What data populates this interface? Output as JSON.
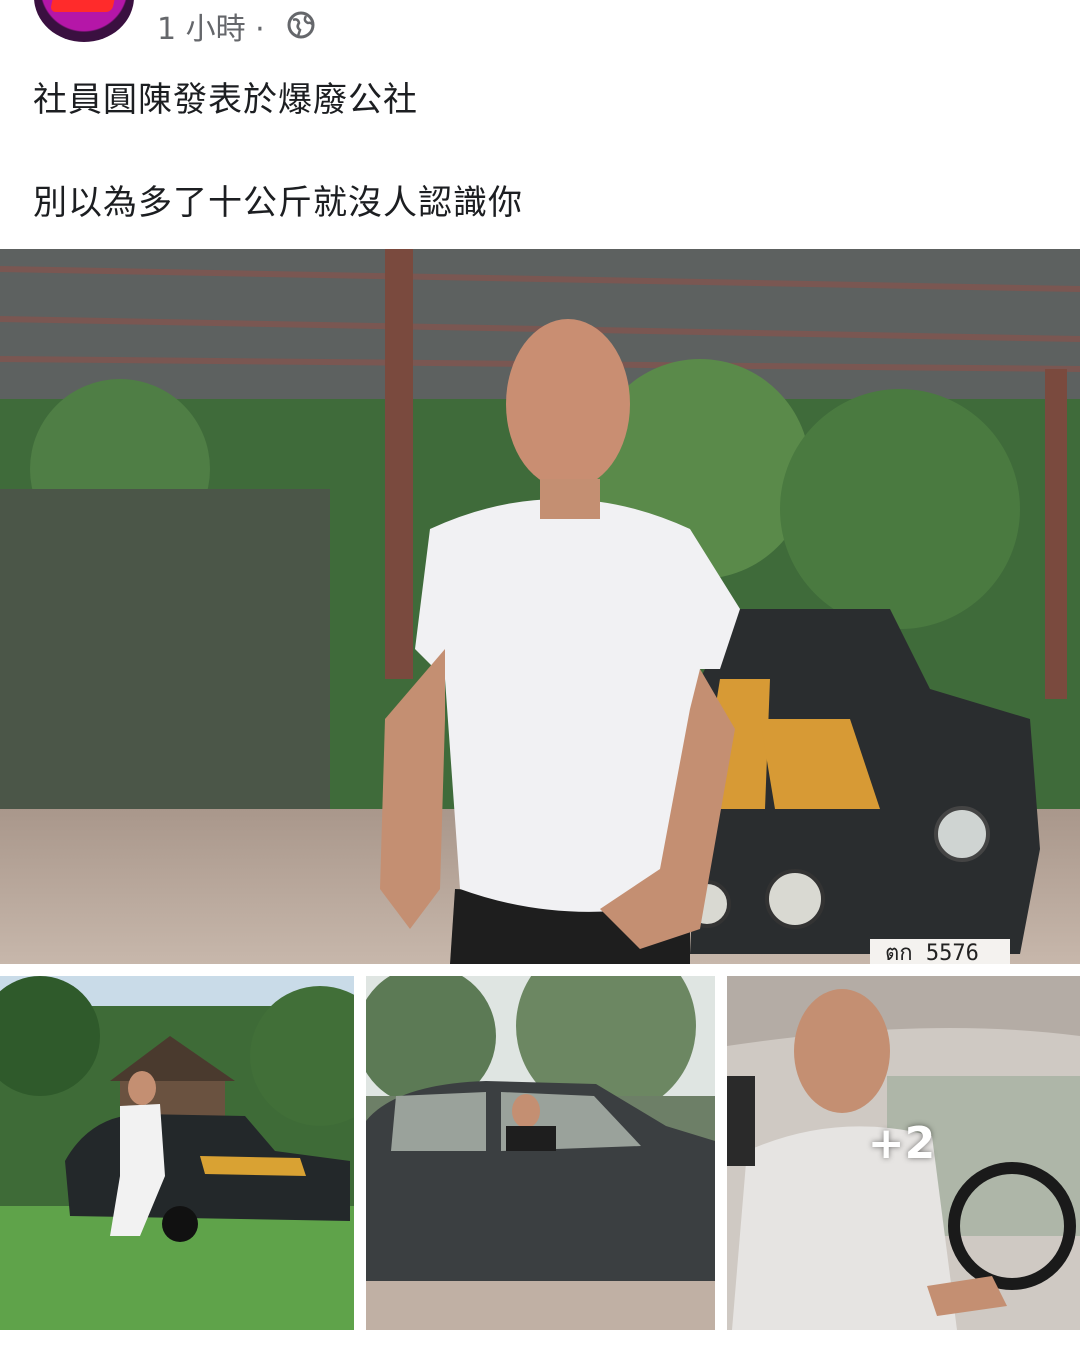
{
  "header": {
    "timestamp": "1 小時",
    "separator": "·",
    "privacy_icon": "globe-icon"
  },
  "post": {
    "line1": "社員圓陳發表於爆廢公社",
    "line2": "別以為多了十公斤就沒人認識你"
  },
  "photos": {
    "main_plate": "ตก 5576",
    "more_count": "+2"
  },
  "colors": {
    "muted_text": "#65676b",
    "text": "#1c1e21"
  }
}
